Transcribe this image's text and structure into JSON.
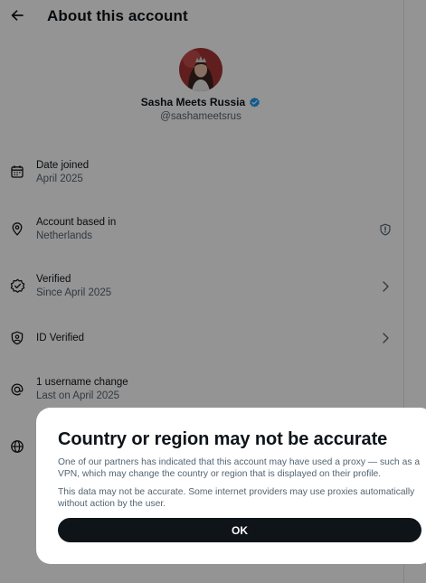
{
  "header": {
    "title": "About this account",
    "back_icon": "arrow-left-icon"
  },
  "profile": {
    "name": "Sasha Meets Russia",
    "handle": "@sashameetsrus",
    "verified_color": "#1d9bf0"
  },
  "rows": [
    {
      "id": "date-joined",
      "icon": "calendar-icon",
      "label": "Date joined",
      "sub": "April 2025"
    },
    {
      "id": "account-based",
      "icon": "location-pin-icon",
      "label": "Account based in",
      "sub": "Netherlands",
      "trail_icon": "shield-alert-icon"
    },
    {
      "id": "verified",
      "icon": "verified-check-icon",
      "label": "Verified",
      "sub": "Since April 2025",
      "trail_icon": "chevron-right-icon"
    },
    {
      "id": "id-verified",
      "icon": "id-shield-icon",
      "label": "ID Verified",
      "sub": "",
      "trail_icon": "chevron-right-icon"
    },
    {
      "id": "username-change",
      "icon": "at-sign-icon",
      "label": "1 username change",
      "sub": "Last on April 2025"
    },
    {
      "id": "connected-via",
      "icon": "globe-icon",
      "label": "",
      "sub": ""
    }
  ],
  "modal": {
    "title": "Country or region may not be accurate",
    "text1": "One of our partners has indicated that this account may have used a proxy — such as a VPN, which may change the country or region that is displayed on their profile.",
    "text2": "This data may not be accurate. Some internet providers may use proxies automatically without action by the user.",
    "ok_label": "OK"
  },
  "colors": {
    "overlay": "rgba(0,0,0,0.42)",
    "primary_text": "#0f1419",
    "secondary_text": "#536471",
    "button_bg": "#0f1419"
  }
}
